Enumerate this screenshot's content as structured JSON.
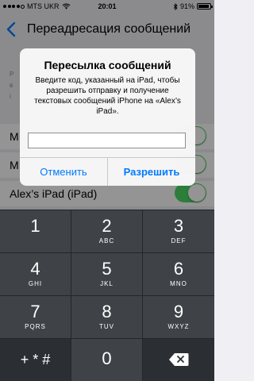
{
  "status": {
    "carrier": "MTS UKR",
    "time": "20:01",
    "battery": "91%",
    "battery_fraction": 0.91
  },
  "navbar": {
    "title": "Переадресация сообщений"
  },
  "background_rows": [
    {
      "label": "M",
      "switch_on": true
    },
    {
      "label": "M",
      "switch_on": true
    },
    {
      "label": "Alex’s iPad (iPad)",
      "switch_on": true
    }
  ],
  "group_label_fragment": "Р\nв\ni",
  "alert": {
    "title": "Пересылка сообщений",
    "message": "Введите код, указанный на iPad, чтобы разрешить отправку и получение текстовых сообщений iPhone на «Alex’s iPad».",
    "input_value": "",
    "cancel_label": "Отменить",
    "allow_label": "Разрешить"
  },
  "keypad": {
    "keys": [
      {
        "num": "1",
        "letters": ""
      },
      {
        "num": "2",
        "letters": "ABC"
      },
      {
        "num": "3",
        "letters": "DEF"
      },
      {
        "num": "4",
        "letters": "GHI"
      },
      {
        "num": "5",
        "letters": "JKL"
      },
      {
        "num": "6",
        "letters": "MNO"
      },
      {
        "num": "7",
        "letters": "PQRS"
      },
      {
        "num": "8",
        "letters": "TUV"
      },
      {
        "num": "9",
        "letters": "WXYZ"
      },
      {
        "num": "0",
        "letters": ""
      }
    ],
    "symbols_label": "+ * #",
    "delete_icon": "backspace-icon"
  }
}
